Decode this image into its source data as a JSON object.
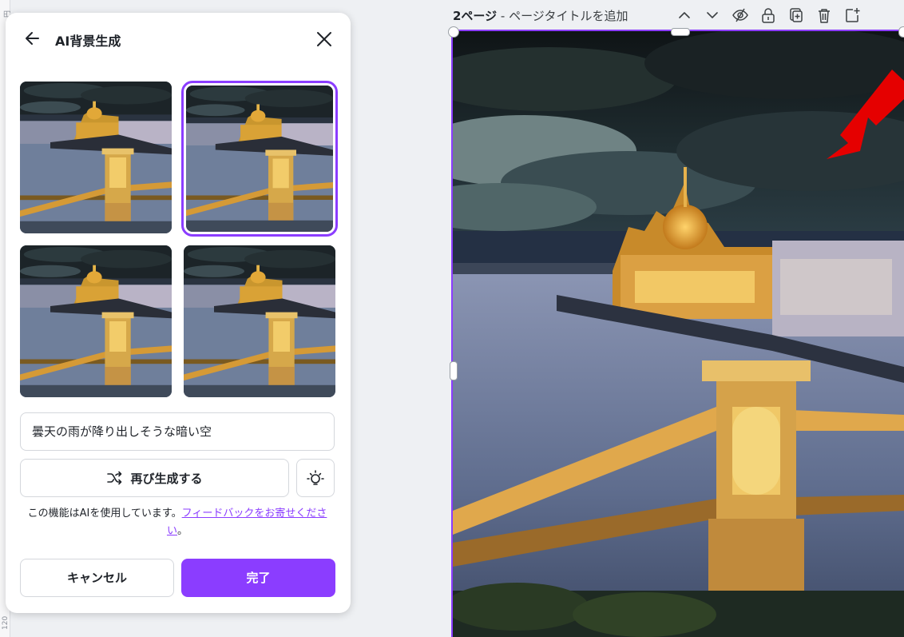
{
  "ruler": {
    "tick_top": "円",
    "tick_bottom": "120"
  },
  "panel": {
    "title": "AI背景生成",
    "prompt_text": "曇天の雨が降り出しそうな暗い空",
    "regenerate_label": "再び生成する",
    "disclaimer_text": "この機能はAIを使用しています。",
    "feedback_link": "フィードバックをお寄せください",
    "disclaimer_end": "。",
    "cancel_label": "キャンセル",
    "done_label": "完了",
    "thumbnails": [
      {
        "selected": false
      },
      {
        "selected": true
      },
      {
        "selected": false
      },
      {
        "selected": false
      }
    ]
  },
  "page_bar": {
    "page_number": "2ページ",
    "separator": " - ",
    "title_placeholder": "ページタイトルを追加"
  },
  "icons": [
    "back-arrow-icon",
    "close-icon",
    "shuffle-icon",
    "lightbulb-icon",
    "chevron-up-icon",
    "chevron-down-icon",
    "eye-hidden-icon",
    "lock-icon",
    "duplicate-page-icon",
    "trash-icon",
    "add-page-icon"
  ],
  "colors": {
    "accent": "#8b3dff",
    "annotation_arrow": "#e50000"
  }
}
